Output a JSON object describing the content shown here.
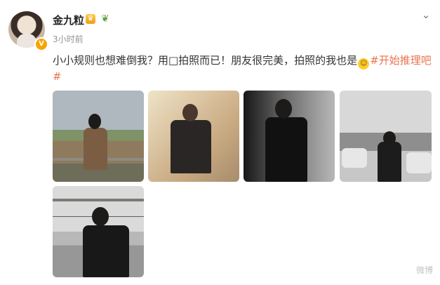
{
  "post": {
    "username": "金九粒",
    "time": "3小时前",
    "text_before_emoji": "小小规则也想难倒我？用□拍照而已！朋友很完美，拍照的我也是",
    "emoji": "😄",
    "hashtag": "#开始推理吧#"
  },
  "watermark": "微博"
}
